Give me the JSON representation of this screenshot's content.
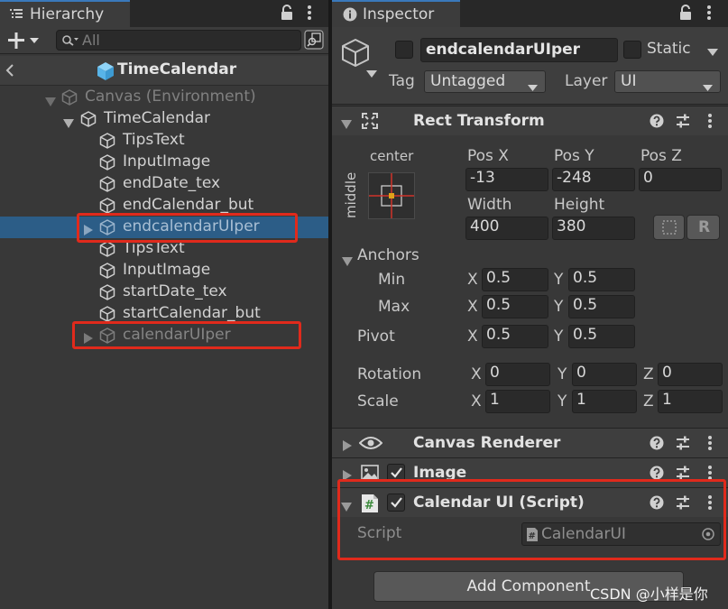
{
  "hierarchy": {
    "tab_title": "Hierarchy",
    "search_placeholder": "All",
    "scene_name": "TimeCalendar",
    "rows": [
      {
        "label": "Canvas (Environment)"
      },
      {
        "label": "TimeCalendar"
      },
      {
        "label": "TipsText"
      },
      {
        "label": "InputImage"
      },
      {
        "label": "endDate_tex"
      },
      {
        "label": "endCalendar_but"
      },
      {
        "label": "endcalendarUIper"
      },
      {
        "label": "TipsText"
      },
      {
        "label": "InputImage"
      },
      {
        "label": "startDate_tex"
      },
      {
        "label": "startCalendar_but"
      },
      {
        "label": "calendarUIper"
      }
    ]
  },
  "inspector": {
    "tab_title": "Inspector",
    "object_name": "endcalendarUIper",
    "static_label": "Static",
    "tag_label": "Tag",
    "tag_value": "Untagged",
    "layer_label": "Layer",
    "layer_value": "UI",
    "rect_transform": {
      "title": "Rect Transform",
      "anchor_h": "center",
      "anchor_v": "middle",
      "pos_x_label": "Pos X",
      "pos_y_label": "Pos Y",
      "pos_z_label": "Pos Z",
      "pos_x": "-13",
      "pos_y": "-248",
      "pos_z": "0",
      "width_label": "Width",
      "height_label": "Height",
      "width": "400",
      "height": "380",
      "r_button": "R",
      "anchors_label": "Anchors",
      "min_label": "Min",
      "max_label": "Max",
      "pivot_label": "Pivot",
      "rotation_label": "Rotation",
      "scale_label": "Scale",
      "x": "X",
      "y": "Y",
      "z": "Z",
      "min_x": "0.5",
      "min_y": "0.5",
      "max_x": "0.5",
      "max_y": "0.5",
      "pivot_x": "0.5",
      "pivot_y": "0.5",
      "rot_x": "0",
      "rot_y": "0",
      "rot_z": "0",
      "scale_x": "1",
      "scale_y": "1",
      "scale_z": "1"
    },
    "canvas_renderer": {
      "title": "Canvas Renderer"
    },
    "image": {
      "title": "Image"
    },
    "calendar_script": {
      "title": "Calendar UI (Script)",
      "script_label": "Script",
      "script_value": "CalendarUI"
    },
    "add_component": "Add Component"
  },
  "watermark": "CSDN @小样是你",
  "colors": {
    "selection": "#2c5d87",
    "highlight_box": "#e02a1c",
    "tab_accent": "#3a79bb"
  }
}
